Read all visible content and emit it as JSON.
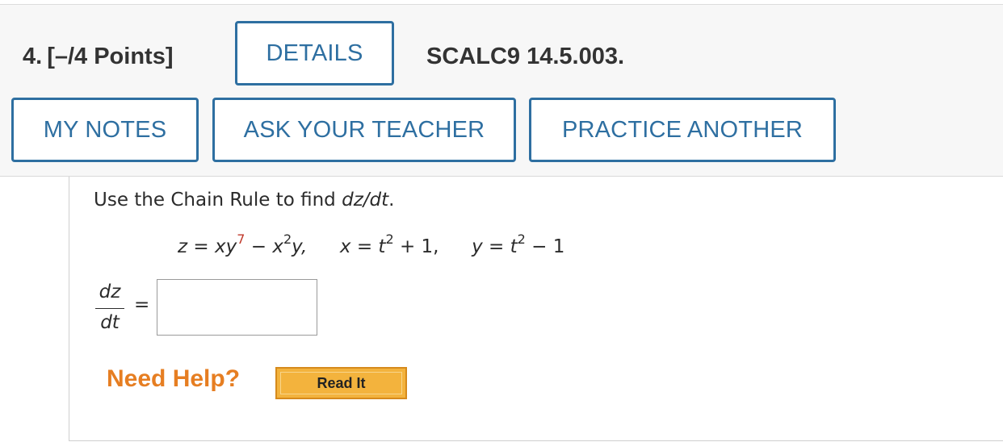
{
  "header": {
    "question_number": "4.",
    "points": "[–/4 Points]",
    "details_label": "DETAILS",
    "problem_code": "SCALC9 14.5.003.",
    "buttons": {
      "my_notes": "MY NOTES",
      "ask_teacher": "ASK YOUR TEACHER",
      "practice_another": "PRACTICE ANOTHER"
    }
  },
  "question": {
    "instruction_prefix": "Use the Chain Rule to find ",
    "instruction_target": "dz/dt",
    "instruction_suffix": ".",
    "equation": {
      "z_lhs": "z",
      "z_rhs_a": "xy",
      "z_rhs_exp1": "7",
      "z_rhs_minus": "−",
      "z_rhs_b": "x",
      "z_rhs_exp2": "2",
      "z_rhs_c": "y,",
      "x_lhs": "x",
      "x_rhs_t": "t",
      "x_rhs_exp": "2",
      "x_rhs_rest": "+ 1,",
      "y_lhs": "y",
      "y_rhs_t": "t",
      "y_rhs_exp": "2",
      "y_rhs_rest": "− 1",
      "equals": "="
    },
    "fraction": {
      "numerator": "dz",
      "denominator": "dt",
      "equals": "="
    },
    "answer": {
      "value": "",
      "placeholder": ""
    }
  },
  "help": {
    "label": "Need Help?",
    "read_it_label": "Read It"
  },
  "colors": {
    "accent_blue": "#2e6fa1",
    "exponent_red": "#c0392b",
    "help_orange": "#e67e22",
    "read_it_bg": "#f3b33d"
  }
}
